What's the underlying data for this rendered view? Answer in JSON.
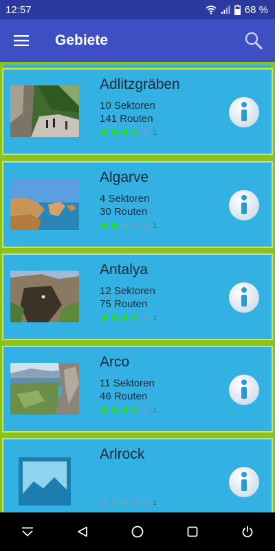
{
  "status": {
    "time": "12:57",
    "battery": "68 %"
  },
  "appbar": {
    "title": "Gebiete",
    "menu_icon": "hamburger-menu-icon",
    "search_icon": "search-icon"
  },
  "areas": [
    {
      "name": "Adlitzgräben",
      "sectors": "10 Sektoren",
      "routes": "141 Routen",
      "stars": 3.5,
      "rating_count": "1",
      "image": "photo"
    },
    {
      "name": "Algarve",
      "sectors": "4 Sektoren",
      "routes": "30 Routen",
      "stars": 2,
      "rating_count": "1",
      "image": "photo"
    },
    {
      "name": "Antalya",
      "sectors": "12 Sektoren",
      "routes": "75 Routen",
      "stars": 3.5,
      "rating_count": "1",
      "image": "photo"
    },
    {
      "name": "Arco",
      "sectors": "11 Sektoren",
      "routes": "46 Routen",
      "stars": 3.5,
      "rating_count": "1",
      "image": "photo"
    },
    {
      "name": "Arlrock",
      "sectors": "",
      "routes": "",
      "stars": 0,
      "rating_count": "1",
      "image": "placeholder"
    }
  ],
  "colors": {
    "status_bar": "#2c3aa0",
    "app_bar": "#3d4fc3",
    "card": "#33b1e3",
    "divider": "#8bc21c",
    "star_filled": "#22dd22",
    "star_empty": "#5aa7c9"
  },
  "navbar": {
    "items": [
      "collapse-icon",
      "back-icon",
      "home-icon",
      "recents-icon",
      "power-icon"
    ]
  }
}
